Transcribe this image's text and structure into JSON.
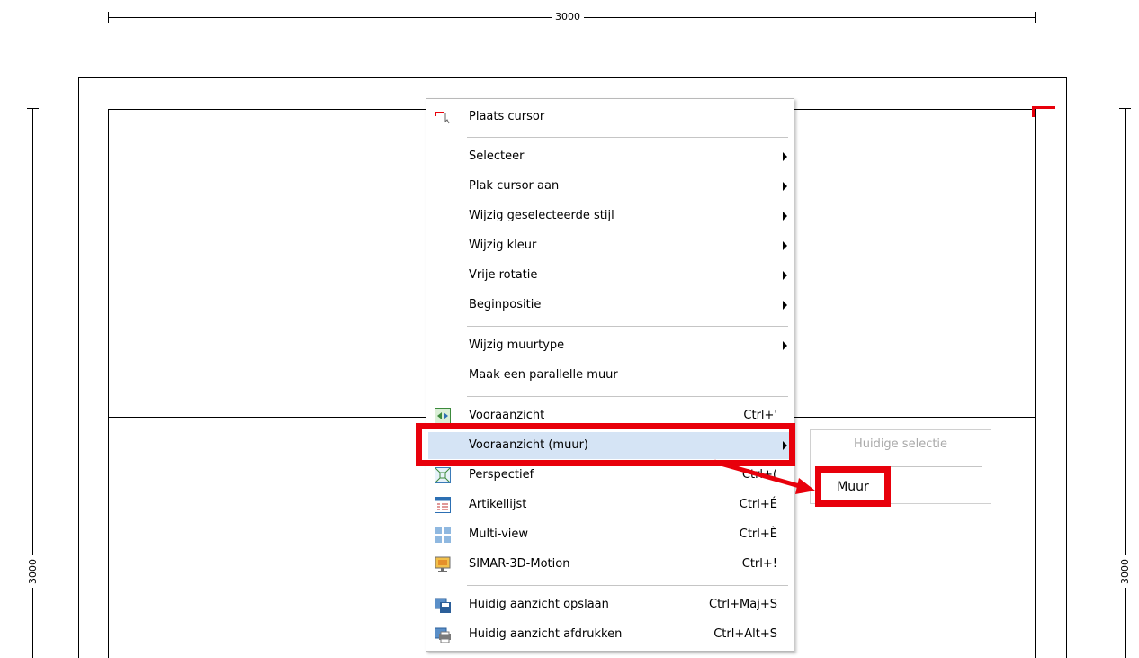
{
  "dimensions": {
    "top": "3000",
    "left": "3000",
    "right": "3000"
  },
  "menu": {
    "items": [
      {
        "label": "Plaats cursor",
        "icon": "cursor-place-icon",
        "submenu": false,
        "shortcut": ""
      },
      {
        "label": "Selecteer",
        "submenu": true,
        "shortcut": ""
      },
      {
        "label": "Plak cursor aan",
        "submenu": true,
        "shortcut": ""
      },
      {
        "label": "Wijzig geselecteerde stijl",
        "submenu": true,
        "shortcut": ""
      },
      {
        "label": "Wijzig kleur",
        "submenu": true,
        "shortcut": ""
      },
      {
        "label": "Vrije rotatie",
        "submenu": true,
        "shortcut": ""
      },
      {
        "label": "Beginpositie",
        "submenu": true,
        "shortcut": ""
      },
      {
        "label": "Wijzig muurtype",
        "submenu": true,
        "shortcut": ""
      },
      {
        "label": "Maak een parallelle muur",
        "submenu": false,
        "shortcut": ""
      },
      {
        "label": "Vooraanzicht",
        "icon": "front-view-icon",
        "submenu": false,
        "shortcut": "Ctrl+'"
      },
      {
        "label": "Vooraanzicht (muur)",
        "submenu": true,
        "shortcut": "",
        "highlighted": true
      },
      {
        "label": "Perspectief",
        "icon": "perspective-icon",
        "submenu": false,
        "shortcut": "Ctrl+("
      },
      {
        "label": "Artikellijst",
        "icon": "article-list-icon",
        "submenu": false,
        "shortcut": "Ctrl+É"
      },
      {
        "label": "Multi-view",
        "icon": "multi-view-icon",
        "submenu": false,
        "shortcut": "Ctrl+È"
      },
      {
        "label": "SIMAR-3D-Motion",
        "icon": "monitor-3d-icon",
        "submenu": false,
        "shortcut": "Ctrl+!"
      },
      {
        "label": "Huidig aanzicht opslaan",
        "icon": "save-view-icon",
        "submenu": false,
        "shortcut": "Ctrl+Maj+S"
      },
      {
        "label": "Huidig aanzicht afdrukken",
        "icon": "print-view-icon",
        "submenu": false,
        "shortcut": "Ctrl+Alt+S"
      }
    ]
  },
  "submenu": {
    "disabled_item": "Huidige selectie",
    "item": "Muur"
  },
  "colors": {
    "annotation_red": "#e8000b",
    "hover_blue": "#d5e4f5"
  }
}
